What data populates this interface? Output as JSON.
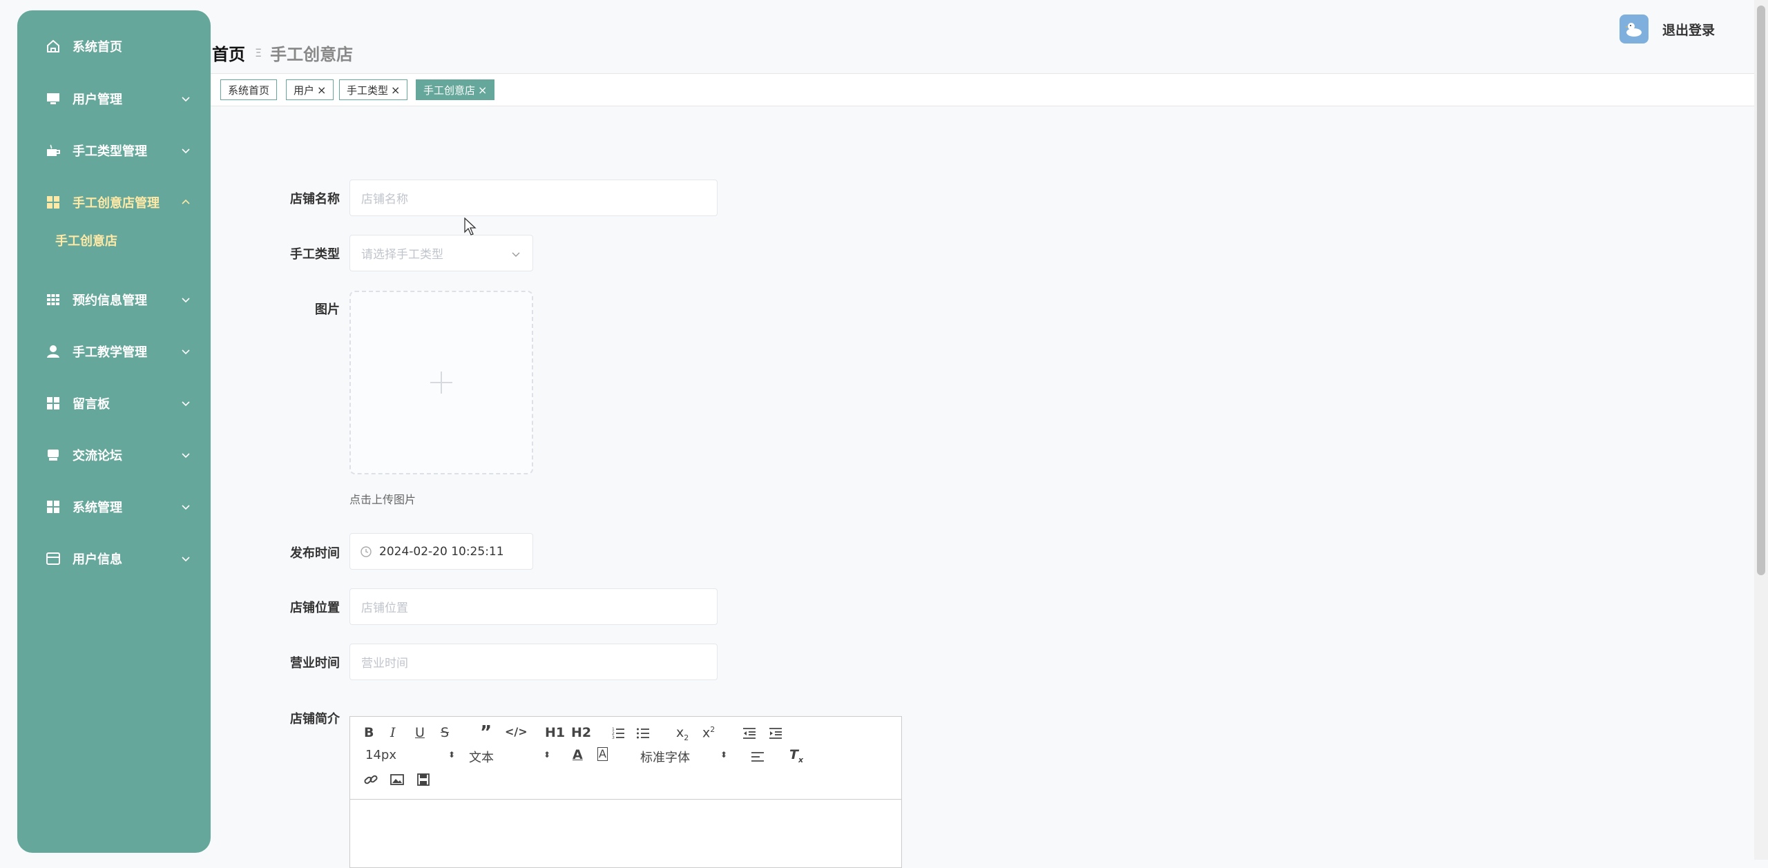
{
  "sidebar": {
    "items": [
      {
        "label": "系统首页",
        "icon": "home-icon",
        "expanded": false,
        "has_arrow": false
      },
      {
        "label": "用户管理",
        "icon": "monitor-icon",
        "expanded": false,
        "has_arrow": true
      },
      {
        "label": "手工类型管理",
        "icon": "cup-icon",
        "expanded": false,
        "has_arrow": true
      },
      {
        "label": "手工创意店管理",
        "icon": "grid-icon",
        "expanded": true,
        "has_arrow": true
      },
      {
        "label": "预约信息管理",
        "icon": "table-grid-icon",
        "expanded": false,
        "has_arrow": true
      },
      {
        "label": "手工教学管理",
        "icon": "user-icon",
        "expanded": false,
        "has_arrow": true
      },
      {
        "label": "留言板",
        "icon": "grid-icon",
        "expanded": false,
        "has_arrow": true
      },
      {
        "label": "交流论坛",
        "icon": "printer-icon",
        "expanded": false,
        "has_arrow": true
      },
      {
        "label": "系统管理",
        "icon": "grid-icon",
        "expanded": false,
        "has_arrow": true
      },
      {
        "label": "用户信息",
        "icon": "card-icon",
        "expanded": false,
        "has_arrow": true
      }
    ],
    "sub_item": "手工创意店"
  },
  "breadcrumb": {
    "home": "首页",
    "separator": "Ξ",
    "current": "手工创意店"
  },
  "header": {
    "logout": "退出登录"
  },
  "tags": [
    {
      "label": "系统首页",
      "closable": false,
      "active": false
    },
    {
      "label": "用户",
      "closable": true,
      "active": false
    },
    {
      "label": "手工类型",
      "closable": true,
      "active": false
    },
    {
      "label": "手工创意店",
      "closable": true,
      "active": true
    }
  ],
  "form": {
    "shop_name": {
      "label": "店铺名称",
      "placeholder": "店铺名称",
      "value": ""
    },
    "craft_type": {
      "label": "手工类型",
      "placeholder": "请选择手工类型",
      "value": ""
    },
    "image": {
      "label": "图片",
      "hint": "点击上传图片"
    },
    "publish_time": {
      "label": "发布时间",
      "value": "2024-02-20 10:25:11"
    },
    "location": {
      "label": "店铺位置",
      "placeholder": "店铺位置",
      "value": ""
    },
    "hours": {
      "label": "营业时间",
      "placeholder": "营业时间",
      "value": ""
    },
    "intro": {
      "label": "店铺简介"
    }
  },
  "editor": {
    "size": "14px",
    "header": "文本",
    "font": "标准字体",
    "h1": "H1",
    "h2": "H2"
  },
  "colors": {
    "accent": "#65a79a",
    "submenu_active": "#ffe9a6"
  }
}
